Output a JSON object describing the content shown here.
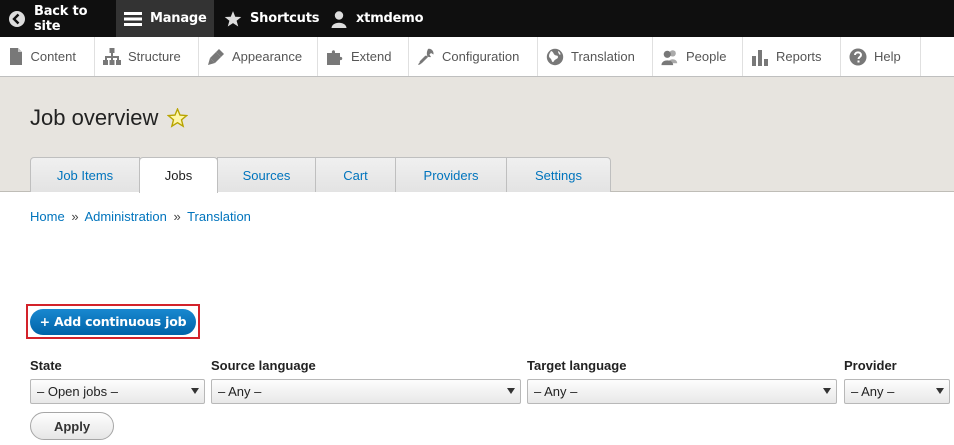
{
  "toolbar": {
    "back_label": "Back to site",
    "manage_label": "Manage",
    "shortcuts_label": "Shortcuts",
    "user_label": "xtmdemo"
  },
  "tray": {
    "items": [
      {
        "label": "Content",
        "icon": "page-icon"
      },
      {
        "label": "Structure",
        "icon": "hierarchy-icon"
      },
      {
        "label": "Appearance",
        "icon": "paintbrush-icon"
      },
      {
        "label": "Extend",
        "icon": "puzzle-icon"
      },
      {
        "label": "Configuration",
        "icon": "wrench-icon"
      },
      {
        "label": "Translation",
        "icon": "globe-icon"
      },
      {
        "label": "People",
        "icon": "people-icon"
      },
      {
        "label": "Reports",
        "icon": "bar-chart-icon"
      },
      {
        "label": "Help",
        "icon": "question-icon"
      }
    ]
  },
  "page": {
    "title": "Job overview"
  },
  "tabs": [
    {
      "label": "Job Items",
      "active": false
    },
    {
      "label": "Jobs",
      "active": true
    },
    {
      "label": "Sources",
      "active": false
    },
    {
      "label": "Cart",
      "active": false
    },
    {
      "label": "Providers",
      "active": false
    },
    {
      "label": "Settings",
      "active": false
    }
  ],
  "breadcrumb": {
    "items": [
      "Home",
      "Administration",
      "Translation"
    ],
    "separator": "»"
  },
  "actions": {
    "add_continuous_job": "+ Add continuous job"
  },
  "filters": {
    "state": {
      "label": "State",
      "value": "– Open jobs –"
    },
    "source_language": {
      "label": "Source language",
      "value": "– Any –"
    },
    "target_language": {
      "label": "Target language",
      "value": "– Any –"
    },
    "provider": {
      "label": "Provider",
      "value": "– Any –"
    },
    "apply_label": "Apply"
  },
  "colors": {
    "accent": "#0074bd",
    "highlight_border": "#d3222a",
    "toolbar_bg": "#0f0f0f",
    "header_bg": "#e7e4df"
  }
}
